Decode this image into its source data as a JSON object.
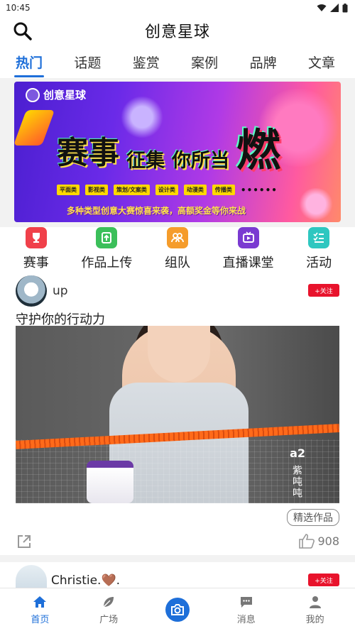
{
  "status_bar": {
    "time": "10:45"
  },
  "header": {
    "title": "创意星球"
  },
  "tabs": [
    {
      "label": "热门",
      "active": true
    },
    {
      "label": "话题",
      "active": false
    },
    {
      "label": "鉴赏",
      "active": false
    },
    {
      "label": "案例",
      "active": false
    },
    {
      "label": "品牌",
      "active": false
    },
    {
      "label": "文章",
      "active": false
    }
  ],
  "banner": {
    "logo_text": "创意星球",
    "headline": [
      "赛事",
      "征集",
      "你所当",
      "燃"
    ],
    "categories": [
      "平面类",
      "影视类",
      "策划/文案类",
      "设计类",
      "动漫类",
      "传播类"
    ],
    "dots": "••••••",
    "subtitle": "多种类型创意大赛惊喜来袭，高额奖金等你来战"
  },
  "quick_actions": [
    {
      "label": "赛事",
      "icon": "trophy-icon",
      "color": "#f0404a"
    },
    {
      "label": "作品上传",
      "icon": "upload-doc-icon",
      "color": "#3bbf5a"
    },
    {
      "label": "组队",
      "icon": "team-icon",
      "color": "#f59c2b"
    },
    {
      "label": "直播课堂",
      "icon": "live-tv-icon",
      "color": "#7a3ad1"
    },
    {
      "label": "活动",
      "icon": "checklist-icon",
      "color": "#2ec7c0"
    }
  ],
  "post": {
    "username": "up",
    "follow_label": "+关注",
    "text": "守护你的行动力",
    "image_brand": "a2",
    "image_brand_vertical": "紫吨吨",
    "featured_label": "精选作品",
    "likes": "908"
  },
  "post2": {
    "username": "Christie.🤎.",
    "follow_label": "+关注"
  },
  "bottom_nav": [
    {
      "label": "首页",
      "icon": "home-icon",
      "active": true
    },
    {
      "label": "广场",
      "icon": "plaza-icon",
      "active": false
    },
    {
      "label": "",
      "icon": "camera-icon",
      "active": false
    },
    {
      "label": "消息",
      "icon": "message-icon",
      "active": false
    },
    {
      "label": "我的",
      "icon": "profile-icon",
      "active": false
    }
  ],
  "colors": {
    "accent": "#1e6fd9",
    "follow": "#e8132c"
  }
}
